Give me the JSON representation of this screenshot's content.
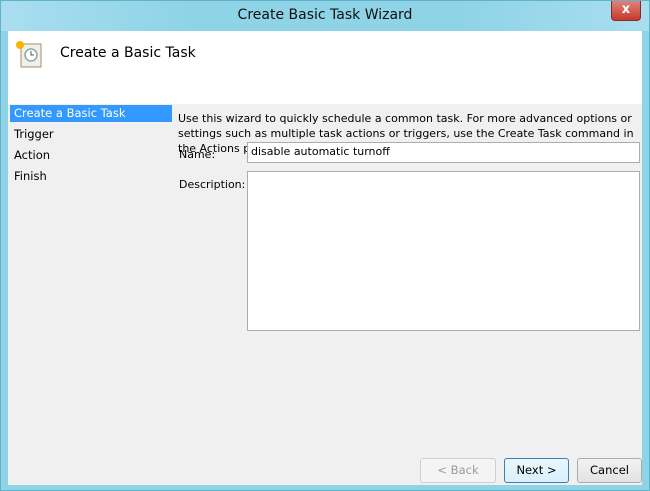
{
  "window": {
    "title": "Create Basic Task Wizard",
    "close_label": "x"
  },
  "header": {
    "title": "Create a Basic Task"
  },
  "sidebar": {
    "items": [
      {
        "label": "Create a Basic Task"
      },
      {
        "label": "Trigger"
      },
      {
        "label": "Action"
      },
      {
        "label": "Finish"
      }
    ]
  },
  "main": {
    "intro": "Use this wizard to quickly schedule a common task.  For more advanced options or settings such as multiple task actions or triggers, use the Create Task command in the Actions pane.",
    "name_label": "Name:",
    "name_value": "disable automatic turnoff",
    "description_label": "Description:",
    "description_value": ""
  },
  "buttons": {
    "back": "< Back",
    "next": "Next >",
    "cancel": "Cancel"
  }
}
